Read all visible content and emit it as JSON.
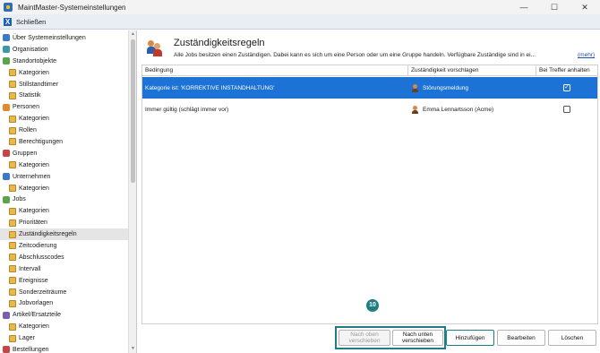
{
  "window": {
    "title": "MaintMaster-Systemeinstellungen",
    "minimize_glyph": "—",
    "maximize_glyph": "☐",
    "close_glyph": "✕"
  },
  "toolbar": {
    "close_icon": "X",
    "close_label": "Schließen"
  },
  "sidebar": {
    "items": [
      {
        "label": "Über Systemeinstellungen",
        "level": 0,
        "icon": "info-icon"
      },
      {
        "label": "Organisation",
        "level": 0,
        "icon": "organisation-icon"
      },
      {
        "label": "Standortobjekte",
        "level": 0,
        "icon": "location-icon"
      },
      {
        "label": "Kategorien",
        "level": 1,
        "icon": "folder-icon"
      },
      {
        "label": "Stillstandtimer",
        "level": 1,
        "icon": "folder-icon"
      },
      {
        "label": "Statistik",
        "level": 1,
        "icon": "folder-icon"
      },
      {
        "label": "Personen",
        "level": 0,
        "icon": "person-icon"
      },
      {
        "label": "Kategorien",
        "level": 1,
        "icon": "folder-icon"
      },
      {
        "label": "Rollen",
        "level": 1,
        "icon": "folder-icon"
      },
      {
        "label": "Berechtigungen",
        "level": 1,
        "icon": "folder-icon"
      },
      {
        "label": "Gruppen",
        "level": 0,
        "icon": "group-icon"
      },
      {
        "label": "Kategorien",
        "level": 1,
        "icon": "folder-icon"
      },
      {
        "label": "Unternehmen",
        "level": 0,
        "icon": "company-icon"
      },
      {
        "label": "Kategorien",
        "level": 1,
        "icon": "folder-icon"
      },
      {
        "label": "Jobs",
        "level": 0,
        "icon": "jobs-icon"
      },
      {
        "label": "Kategorien",
        "level": 1,
        "icon": "folder-icon"
      },
      {
        "label": "Prioritäten",
        "level": 1,
        "icon": "folder-icon"
      },
      {
        "label": "Zuständigkeitsregeln",
        "level": 1,
        "icon": "folder-icon",
        "selected": true
      },
      {
        "label": "Zeitcodierung",
        "level": 1,
        "icon": "folder-icon"
      },
      {
        "label": "Abschlusscodes",
        "level": 1,
        "icon": "folder-icon"
      },
      {
        "label": "Intervall",
        "level": 1,
        "icon": "folder-icon"
      },
      {
        "label": "Ereignisse",
        "level": 1,
        "icon": "folder-icon"
      },
      {
        "label": "Sonderzeiträume",
        "level": 1,
        "icon": "folder-icon"
      },
      {
        "label": "Jobvorlagen",
        "level": 1,
        "icon": "folder-icon"
      },
      {
        "label": "Artikel/Ersatzteile",
        "level": 0,
        "icon": "parts-icon"
      },
      {
        "label": "Kategorien",
        "level": 1,
        "icon": "folder-icon"
      },
      {
        "label": "Lager",
        "level": 1,
        "icon": "folder-icon"
      },
      {
        "label": "Bestellungen",
        "level": 0,
        "icon": "orders-icon"
      }
    ]
  },
  "main": {
    "title": "Zuständigkeitsregeln",
    "description": "Alle Jobs besitzen einen Zuständigen. Dabei kann es sich um eine Person oder um eine Gruppe handeln. Verfügbare Zuständige sind in ei...",
    "more_link": "(mehr)",
    "columns": [
      "Bedingung",
      "Zuständigkeit vorschlagen",
      "Bei Treffer anhalten"
    ],
    "rows": [
      {
        "condition": "Kategorie ist: 'KORREKTIVE INSTANDHALTUNG'",
        "assignee": "Störungsmeldung",
        "stop_on_match": true,
        "selected": true
      },
      {
        "condition": "Immer gültig (schlägt immer vor)",
        "assignee": "Emma Lennartsson (Acme)",
        "stop_on_match": false,
        "selected": false
      }
    ]
  },
  "callout": {
    "number": "10",
    "color": "#1f7e83"
  },
  "buttons": {
    "move_up": "Nach oben verschieben",
    "move_down": "Nach unten verschieben",
    "add": "Hinzufügen",
    "edit": "Bearbeiten",
    "delete": "Löschen"
  },
  "colors": {
    "selection": "#1d72d6",
    "accent": "#1f7e83",
    "link": "#1f4fb0"
  }
}
